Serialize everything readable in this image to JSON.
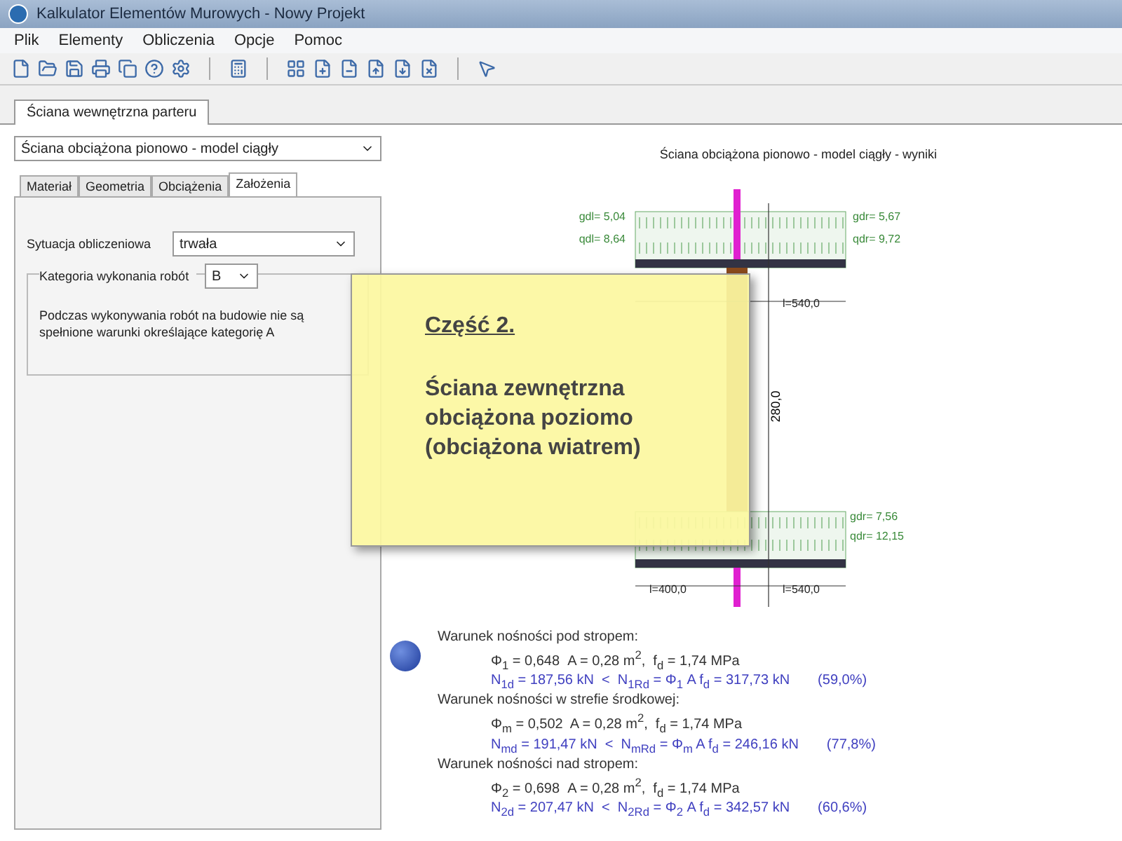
{
  "window": {
    "title": "Kalkulator Elementów Murowych - Nowy Projekt"
  },
  "menu": [
    "Plik",
    "Elementy",
    "Obliczenia",
    "Opcje",
    "Pomoc"
  ],
  "tabs": [
    {
      "label": "Ściana wewnętrzna parteru",
      "selected": true
    }
  ],
  "model_select": {
    "value": "Ściana obciążona pionowo - model ciągły"
  },
  "inner_tabs": [
    {
      "label": "Materiał",
      "selected": false
    },
    {
      "label": "Geometria",
      "selected": false
    },
    {
      "label": "Obciążenia",
      "selected": false
    },
    {
      "label": "Założenia",
      "selected": true
    }
  ],
  "situation": {
    "label": "Sytuacja obliczeniowa",
    "value": "trwała"
  },
  "category": {
    "label": "Kategoria wykonania robót",
    "value": "B",
    "description": "Podczas wykonywania robót na budowie nie są spełnione warunki określające kategorię A"
  },
  "diagram": {
    "title": "Ściana obciążona pionowo - model ciągły - wyniki",
    "labels": [
      "gdl= 5,04",
      "qdl= 8,64",
      "gdr= 5,67",
      "qdr= 9,72",
      "l=540,0",
      "280,0",
      "gdr= 7,56",
      "qdr= 12,15",
      "l=400,0",
      "l=540,0"
    ]
  },
  "results": [
    {
      "kind": "heading",
      "text": "Warunek nośności pod stropem:"
    },
    {
      "kind": "params",
      "text": "Φ$_{1}$ = 0,648  A = 0,28 m$^{2}$,  f$_{d}$ = 1,74 MPa"
    },
    {
      "kind": "check",
      "text": "N$_{1d}$ = 187,56 kN  <  N$_{1Rd}$ = Φ$_{1}$ A f$_{d}$ = 317,73 kN",
      "percent": "(59,0%)"
    },
    {
      "kind": "heading",
      "text": "Warunek nośności w strefie środkowej:"
    },
    {
      "kind": "params",
      "text": "Φ$_{m}$ = 0,502  A = 0,28 m$^{2}$,  f$_{d}$ = 1,74 MPa"
    },
    {
      "kind": "check",
      "text": "N$_{md}$ = 191,47 kN  <  N$_{mRd}$ = Φ$_{m}$ A f$_{d}$ = 246,16 kN",
      "percent": "(77,8%)"
    },
    {
      "kind": "heading",
      "text": "Warunek nośności nad stropem:"
    },
    {
      "kind": "params",
      "text": "Φ$_{2}$ = 0,698  A = 0,28 m$^{2}$,  f$_{d}$ = 1,74 MPa"
    },
    {
      "kind": "check",
      "text": "N$_{2d}$ = 207,47 kN  <  N$_{2Rd}$ = Φ$_{2}$ A f$_{d}$ = 342,57 kN",
      "percent": "(60,6%)"
    }
  ],
  "note": {
    "heading": "Część 2.",
    "body": "Ściana zewnętrzna obciążona poziomo (obciążona wiatrem)"
  }
}
